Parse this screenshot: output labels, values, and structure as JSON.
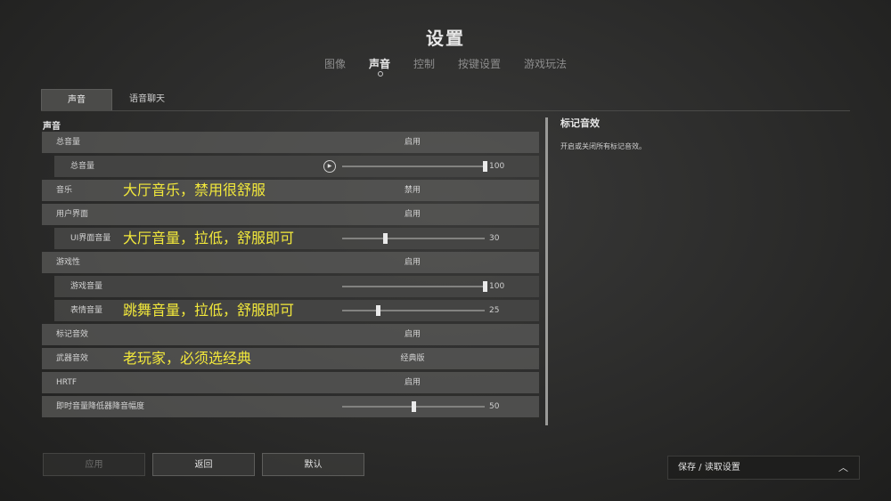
{
  "header": {
    "title": "设置"
  },
  "top_tabs": [
    {
      "label": "图像",
      "active": false
    },
    {
      "label": "声音",
      "active": true
    },
    {
      "label": "控制",
      "active": false
    },
    {
      "label": "按键设置",
      "active": false
    },
    {
      "label": "游戏玩法",
      "active": false
    }
  ],
  "sub_tabs": [
    {
      "label": "声音",
      "active": true
    },
    {
      "label": "语音聊天",
      "active": false
    }
  ],
  "section": {
    "title": "声音"
  },
  "rows": [
    {
      "label": "总音量",
      "value": "启用"
    },
    {
      "label": "总音量",
      "slider": 1.0,
      "number": "100",
      "play_icon": "play-icon"
    },
    {
      "label": "音乐",
      "value": "禁用",
      "annotation": "大厅音乐，禁用很舒服"
    },
    {
      "label": "用户界面",
      "value": "启用"
    },
    {
      "label": "UI界面音量",
      "slider": 0.3,
      "number": "30",
      "annotation": "大厅音量，拉低，舒服即可"
    },
    {
      "label": "游戏性",
      "value": "启用"
    },
    {
      "label": "游戏音量",
      "slider": 1.0,
      "number": "100"
    },
    {
      "label": "表情音量",
      "slider": 0.25,
      "number": "25",
      "annotation": "跳舞音量，拉低，舒服即可"
    },
    {
      "label": "标记音效",
      "value": "启用"
    },
    {
      "label": "武器音效",
      "value": "经典版",
      "annotation": "老玩家，必须选经典"
    },
    {
      "label": "HRTF",
      "value": "启用"
    },
    {
      "label": "即时音量降低器降音幅度",
      "slider": 0.5,
      "number": "50"
    }
  ],
  "info": {
    "title": "标记音效",
    "description": "开启或关闭所有标记音效。"
  },
  "buttons": {
    "apply": "应用",
    "back": "返回",
    "default": "默认"
  },
  "save_panel": {
    "label": "保存 / 读取设置",
    "icon": "chevron-up-icon"
  },
  "colors": {
    "annotation": "#f3e93b"
  }
}
